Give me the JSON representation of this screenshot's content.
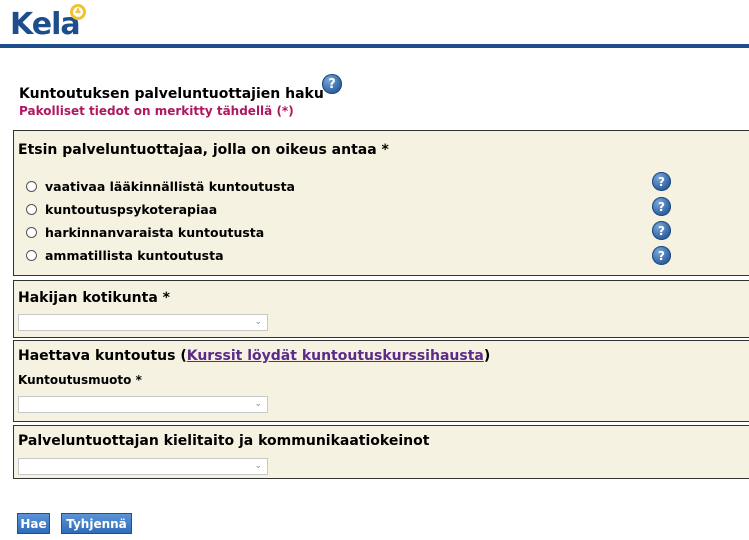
{
  "header": {
    "logo_text": "Kela"
  },
  "page": {
    "title": "Kuntoutuksen palveluntuottajien haku",
    "required_note": "Pakolliset tiedot on merkitty tähdellä (*)"
  },
  "provider_right": {
    "title": "Etsin palveluntuottajaa, jolla on oikeus antaa *",
    "options": [
      {
        "label": "vaativaa lääkinnällistä kuntoutusta"
      },
      {
        "label": "kuntoutuspsykoterapiaa"
      },
      {
        "label": "harkinnanvaraista kuntoutusta"
      },
      {
        "label": "ammatillista kuntoutusta"
      }
    ]
  },
  "home_municipality": {
    "title": "Hakijan kotikunta *",
    "selected": ""
  },
  "rehab": {
    "title_prefix": "Haettava kuntoutus (",
    "link_text": "Kurssit löydät kuntoutuskurssihausta",
    "title_suffix": ")",
    "form_label": "Kuntoutusmuoto *",
    "selected": ""
  },
  "language": {
    "title": "Palveluntuottajan kielitaito ja kommunikaatiokeinot",
    "selected": ""
  },
  "buttons": {
    "search": "Hae",
    "clear": "Tyhjennä"
  },
  "icons": {
    "help": "?"
  },
  "colors": {
    "brand": "#1d4d8c",
    "required": "#b0175f",
    "panel": "#f5f2e1",
    "link": "#5c2a8a"
  }
}
